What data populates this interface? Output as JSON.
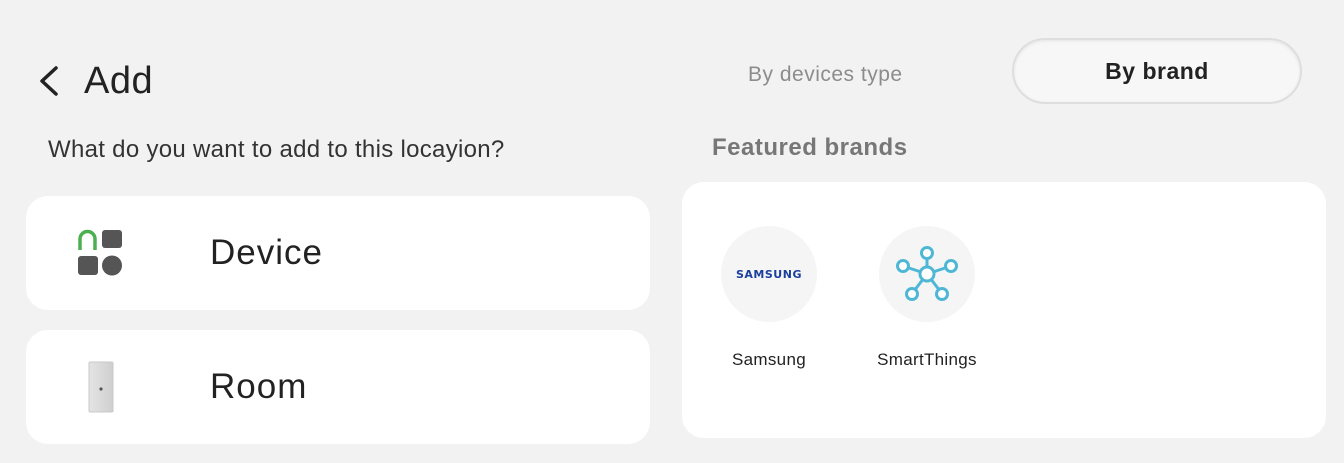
{
  "header": {
    "title": "Add",
    "back_icon": "chevron-left-icon"
  },
  "question": "What do you want to add to this locayion?",
  "options": [
    {
      "label": "Device",
      "icon": "device-grid-icon"
    },
    {
      "label": "Room",
      "icon": "room-door-icon"
    }
  ],
  "view_toggle": {
    "inactive_label": "By devices type",
    "active_label": "By brand"
  },
  "featured": {
    "title": "Featured brands",
    "brands": [
      {
        "label": "Samsung",
        "logo_text": "SAMSUNG",
        "icon": "samsung-logo-icon",
        "logo_color": "#1b3f9c"
      },
      {
        "label": "SmartThings",
        "icon": "smartthings-logo-icon",
        "logo_color": "#4fb7d6"
      }
    ]
  },
  "colors": {
    "background": "#f2f2f2",
    "card": "#ffffff",
    "device_icon_accent": "#4caf50",
    "device_icon_dark": "#555555"
  }
}
